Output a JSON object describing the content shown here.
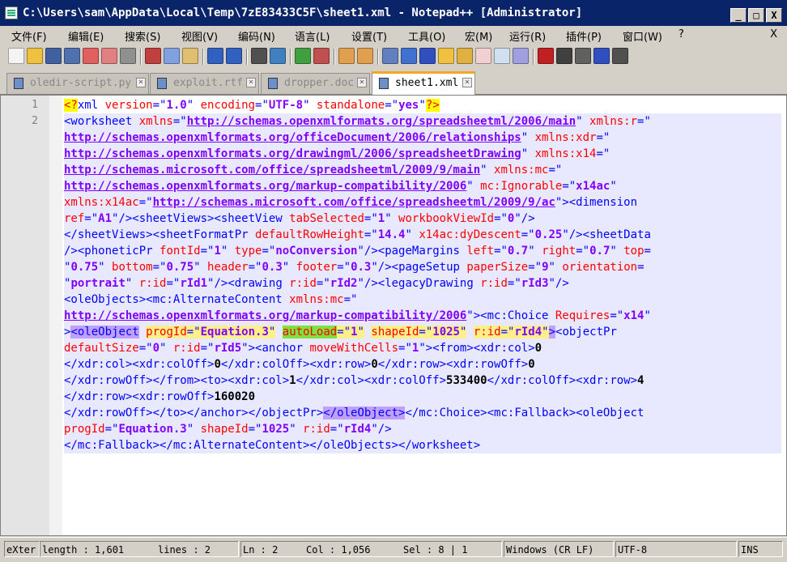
{
  "window": {
    "title": "C:\\Users\\sam\\AppData\\Local\\Temp\\7zE83433C5F\\sheet1.xml - Notepad++ [Administrator]",
    "buttons": {
      "minimize": "_",
      "maximize": "□",
      "close": "X"
    }
  },
  "menu": {
    "items": [
      "文件(F)",
      "编辑(E)",
      "搜索(S)",
      "视图(V)",
      "编码(N)",
      "语言(L)",
      "设置(T)",
      "工具(O)",
      "宏(M)",
      "运行(R)",
      "插件(P)",
      "窗口(W)",
      "?"
    ],
    "close_label": "X"
  },
  "toolbar": {
    "icons": [
      "new-file-icon",
      "open-file-icon",
      "save-icon",
      "save-all-icon",
      "close-icon",
      "close-all-icon",
      "print-icon",
      "cut-icon",
      "copy-icon",
      "paste-icon",
      "undo-icon",
      "redo-icon",
      "find-icon",
      "replace-icon",
      "zoom-in-icon",
      "zoom-out-icon",
      "sync-vertical-icon",
      "sync-horizontal-icon",
      "word-wrap-icon",
      "show-all-chars-icon",
      "indent-guide-icon",
      "doc-map-icon",
      "function-list-icon",
      "folder-workspace-icon",
      "doc-list-icon",
      "monitoring-icon",
      "record-macro-icon",
      "stop-macro-icon",
      "play-macro-icon",
      "run-macro-multiple-icon",
      "save-macro-icon"
    ]
  },
  "tabs": [
    {
      "label": "oledir-script.py",
      "active": false
    },
    {
      "label": "exploit.rtf",
      "active": false
    },
    {
      "label": "dropper.doc",
      "active": false
    },
    {
      "label": "sheet1.xml",
      "active": true
    }
  ],
  "editor": {
    "line_numbers": [
      "1",
      "2"
    ],
    "lines": [
      [
        [
          "pi",
          "<?"
        ],
        [
          "tag",
          "xml "
        ],
        [
          "attr",
          "version"
        ],
        [
          "tag",
          "=\""
        ],
        [
          "val",
          "1.0"
        ],
        [
          "tag",
          "\" "
        ],
        [
          "attr",
          "encoding"
        ],
        [
          "tag",
          "=\""
        ],
        [
          "val",
          "UTF-8"
        ],
        [
          "tag",
          "\" "
        ],
        [
          "attr",
          "standalone"
        ],
        [
          "tag",
          "=\""
        ],
        [
          "val",
          "yes"
        ],
        [
          "tag",
          "\""
        ],
        [
          "pi",
          "?>"
        ]
      ],
      [
        [
          "tag",
          "<worksheet "
        ],
        [
          "attr",
          "xmlns"
        ],
        [
          "tag",
          "=\""
        ],
        [
          "url",
          "http://schemas.openxmlformats.org/spreadsheetml/2006/main"
        ],
        [
          "tag",
          "\" "
        ],
        [
          "attr",
          "xmlns:r"
        ],
        [
          "tag",
          "=\""
        ]
      ],
      [
        [
          "url",
          "http://schemas.openxmlformats.org/officeDocument/2006/relationships"
        ],
        [
          "tag",
          "\" "
        ],
        [
          "attr",
          "xmlns:xdr"
        ],
        [
          "tag",
          "=\""
        ]
      ],
      [
        [
          "url",
          "http://schemas.openxmlformats.org/drawingml/2006/spreadsheetDrawing"
        ],
        [
          "tag",
          "\" "
        ],
        [
          "attr",
          "xmlns:x14"
        ],
        [
          "tag",
          "=\""
        ]
      ],
      [
        [
          "url",
          "http://schemas.microsoft.com/office/spreadsheetml/2009/9/main"
        ],
        [
          "tag",
          "\" "
        ],
        [
          "attr",
          "xmlns:mc"
        ],
        [
          "tag",
          "=\""
        ]
      ],
      [
        [
          "url",
          "http://schemas.openxmlformats.org/markup-compatibility/2006"
        ],
        [
          "tag",
          "\" "
        ],
        [
          "attr",
          "mc:Ignorable"
        ],
        [
          "tag",
          "=\""
        ],
        [
          "val",
          "x14ac"
        ],
        [
          "tag",
          "\""
        ]
      ],
      [
        [
          "attr",
          "xmlns:x14ac"
        ],
        [
          "tag",
          "=\""
        ],
        [
          "url",
          "http://schemas.microsoft.com/office/spreadsheetml/2009/9/ac"
        ],
        [
          "tag",
          "\"><dimension"
        ]
      ],
      [
        [
          "attr",
          "ref"
        ],
        [
          "tag",
          "=\""
        ],
        [
          "val",
          "A1"
        ],
        [
          "tag",
          "\"/><sheetViews><sheetView "
        ],
        [
          "attr",
          "tabSelected"
        ],
        [
          "tag",
          "=\""
        ],
        [
          "val",
          "1"
        ],
        [
          "tag",
          "\" "
        ],
        [
          "attr",
          "workbookViewId"
        ],
        [
          "tag",
          "=\""
        ],
        [
          "val",
          "0"
        ],
        [
          "tag",
          "\"/>"
        ]
      ],
      [
        [
          "tag",
          "</sheetViews><sheetFormatPr "
        ],
        [
          "attr",
          "defaultRowHeight"
        ],
        [
          "tag",
          "=\""
        ],
        [
          "val",
          "14.4"
        ],
        [
          "tag",
          "\" "
        ],
        [
          "attr",
          "x14ac:dyDescent"
        ],
        [
          "tag",
          "=\""
        ],
        [
          "val",
          "0.25"
        ],
        [
          "tag",
          "\"/><sheetData"
        ]
      ],
      [
        [
          "tag",
          "/><phoneticPr "
        ],
        [
          "attr",
          "fontId"
        ],
        [
          "tag",
          "=\""
        ],
        [
          "val",
          "1"
        ],
        [
          "tag",
          "\" "
        ],
        [
          "attr",
          "type"
        ],
        [
          "tag",
          "=\""
        ],
        [
          "val",
          "noConversion"
        ],
        [
          "tag",
          "\"/><pageMargins "
        ],
        [
          "attr",
          "left"
        ],
        [
          "tag",
          "=\""
        ],
        [
          "val",
          "0.7"
        ],
        [
          "tag",
          "\" "
        ],
        [
          "attr",
          "right"
        ],
        [
          "tag",
          "=\""
        ],
        [
          "val",
          "0.7"
        ],
        [
          "tag",
          "\" "
        ],
        [
          "attr",
          "top"
        ],
        [
          "tag",
          "="
        ]
      ],
      [
        [
          "tag",
          "\""
        ],
        [
          "val",
          "0.75"
        ],
        [
          "tag",
          "\" "
        ],
        [
          "attr",
          "bottom"
        ],
        [
          "tag",
          "=\""
        ],
        [
          "val",
          "0.75"
        ],
        [
          "tag",
          "\" "
        ],
        [
          "attr",
          "header"
        ],
        [
          "tag",
          "=\""
        ],
        [
          "val",
          "0.3"
        ],
        [
          "tag",
          "\" "
        ],
        [
          "attr",
          "footer"
        ],
        [
          "tag",
          "=\""
        ],
        [
          "val",
          "0.3"
        ],
        [
          "tag",
          "\"/><pageSetup "
        ],
        [
          "attr",
          "paperSize"
        ],
        [
          "tag",
          "=\""
        ],
        [
          "val",
          "9"
        ],
        [
          "tag",
          "\" "
        ],
        [
          "attr",
          "orientation"
        ],
        [
          "tag",
          "="
        ]
      ],
      [
        [
          "tag",
          "\""
        ],
        [
          "val",
          "portrait"
        ],
        [
          "tag",
          "\" "
        ],
        [
          "attr",
          "r:id"
        ],
        [
          "tag",
          "=\""
        ],
        [
          "val",
          "rId1"
        ],
        [
          "tag",
          "\"/><drawing "
        ],
        [
          "attr",
          "r:id"
        ],
        [
          "tag",
          "=\""
        ],
        [
          "val",
          "rId2"
        ],
        [
          "tag",
          "\"/><legacyDrawing "
        ],
        [
          "attr",
          "r:id"
        ],
        [
          "tag",
          "=\""
        ],
        [
          "val",
          "rId3"
        ],
        [
          "tag",
          "\"/>"
        ]
      ],
      [
        [
          "tag",
          "<oleObjects><mc:AlternateContent "
        ],
        [
          "attr",
          "xmlns:mc"
        ],
        [
          "tag",
          "=\""
        ]
      ],
      [
        [
          "url",
          "http://schemas.openxmlformats.org/markup-compatibility/2006"
        ],
        [
          "tag",
          "\"><mc:Choice "
        ],
        [
          "attr",
          "Requires"
        ],
        [
          "tag",
          "=\""
        ],
        [
          "val",
          "x14"
        ],
        [
          "tag",
          "\""
        ]
      ],
      [
        [
          "tag",
          ">"
        ],
        [
          "match",
          "<oleObject"
        ],
        [
          "tag",
          " "
        ],
        [
          "sel-attr",
          "progId"
        ],
        [
          "sel-tag",
          "=\""
        ],
        [
          "sel-val",
          "Equation.3"
        ],
        [
          "sel-tag",
          "\""
        ],
        [
          "tag",
          " "
        ],
        [
          "green-attr",
          "autoLoad"
        ],
        [
          "sel-tag",
          "=\""
        ],
        [
          "sel-val",
          "1"
        ],
        [
          "sel-tag",
          "\""
        ],
        [
          "tag",
          " "
        ],
        [
          "sel-attr",
          "shapeId"
        ],
        [
          "sel-tag",
          "=\""
        ],
        [
          "sel-val",
          "1025"
        ],
        [
          "sel-tag",
          "\""
        ],
        [
          "tag",
          " "
        ],
        [
          "sel-attr",
          "r:id"
        ],
        [
          "sel-tag",
          "=\""
        ],
        [
          "sel-val",
          "rId4"
        ],
        [
          "sel-tag",
          "\""
        ],
        [
          "match",
          ">"
        ],
        [
          "tag",
          "<objectPr"
        ]
      ],
      [
        [
          "attr",
          "defaultSize"
        ],
        [
          "tag",
          "=\""
        ],
        [
          "val",
          "0"
        ],
        [
          "tag",
          "\" "
        ],
        [
          "attr",
          "r:id"
        ],
        [
          "tag",
          "=\""
        ],
        [
          "val",
          "rId5"
        ],
        [
          "tag",
          "\"><anchor "
        ],
        [
          "attr",
          "moveWithCells"
        ],
        [
          "tag",
          "=\""
        ],
        [
          "val",
          "1"
        ],
        [
          "tag",
          "\"><from><xdr:col>"
        ],
        [
          "text",
          "0"
        ]
      ],
      [
        [
          "tag",
          "</xdr:col><xdr:colOff>"
        ],
        [
          "text",
          "0"
        ],
        [
          "tag",
          "</xdr:colOff><xdr:row>"
        ],
        [
          "text",
          "0"
        ],
        [
          "tag",
          "</xdr:row><xdr:rowOff>"
        ],
        [
          "text",
          "0"
        ]
      ],
      [
        [
          "tag",
          "</xdr:rowOff></from><to><xdr:col>"
        ],
        [
          "text",
          "1"
        ],
        [
          "tag",
          "</xdr:col><xdr:colOff>"
        ],
        [
          "text",
          "533400"
        ],
        [
          "tag",
          "</xdr:colOff><xdr:row>"
        ],
        [
          "text",
          "4"
        ]
      ],
      [
        [
          "tag",
          "</xdr:row><xdr:rowOff>"
        ],
        [
          "text",
          "160020"
        ]
      ],
      [
        [
          "tag",
          "</xdr:rowOff></to></anchor></objectPr>"
        ],
        [
          "match",
          "</oleObject>"
        ],
        [
          "tag",
          "</mc:Choice><mc:Fallback><oleObject"
        ]
      ],
      [
        [
          "attr",
          "progId"
        ],
        [
          "tag",
          "=\""
        ],
        [
          "val",
          "Equation.3"
        ],
        [
          "tag",
          "\" "
        ],
        [
          "attr",
          "shapeId"
        ],
        [
          "tag",
          "=\""
        ],
        [
          "val",
          "1025"
        ],
        [
          "tag",
          "\" "
        ],
        [
          "attr",
          "r:id"
        ],
        [
          "tag",
          "=\""
        ],
        [
          "val",
          "rId4"
        ],
        [
          "tag",
          "\"/>"
        ]
      ],
      [
        [
          "tag",
          "</mc:Fallback></mc:AlternateContent></oleObjects></worksheet>"
        ]
      ]
    ]
  },
  "status": {
    "doc_type": "eXter",
    "length": "length : 1,601",
    "lines": "lines : 2",
    "ln": "Ln : 2",
    "col": "Col : 1,056",
    "sel": "Sel : 8 | 1",
    "eol": "Windows (CR LF)",
    "encoding": "UTF-8",
    "mode": "INS"
  },
  "colors": {
    "tag": "#0000ff",
    "attribute": "#ff0000",
    "value": "#8000ff",
    "current_line": "#e8e8ff",
    "active_tab_accent": "#f5a623"
  }
}
